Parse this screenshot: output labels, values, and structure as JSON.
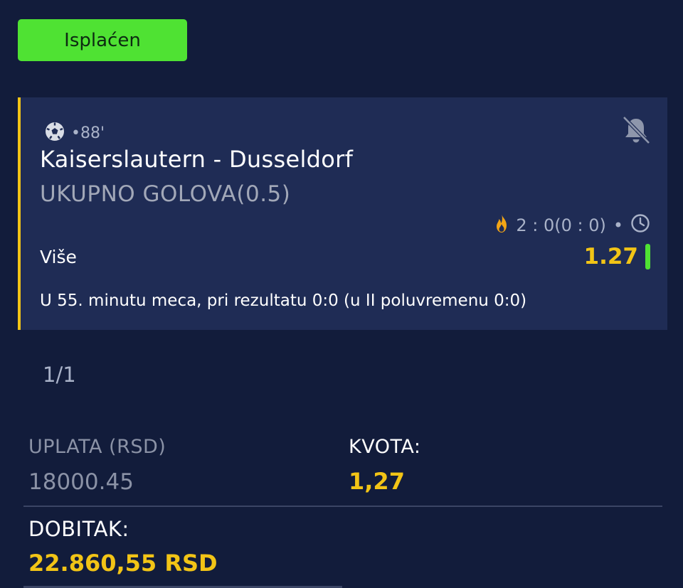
{
  "status": {
    "label": "Isplaćen",
    "color": "#4fe233"
  },
  "ticket": {
    "sport_icon": "soccer-ball-icon",
    "minute": "•88'",
    "match": "Kaiserslautern - Dusseldorf",
    "market": "UKUPNO GOLOVA(0.5)",
    "notification_icon": "bell-off-icon",
    "live_icon": "flame-icon",
    "score": "2 :  0(0 :  0)",
    "score_separator": "•",
    "clock_icon": "clock-icon",
    "pick": "Više",
    "odd": "1.27",
    "odd_indicator_color": "#4fe233",
    "comment": "U 55. minutu meca, pri rezultatu 0:0 (u II poluvremenu 0:0)",
    "accent_color": "#f2c416"
  },
  "pager": "1/1",
  "summary": {
    "stake_label": "UPLATA (RSD)",
    "stake_value": "18000.45",
    "odds_label": "KVOTA:",
    "odds_value": "1,27",
    "win_label": "DOBITAK:",
    "win_value": "22.860,55 RSD"
  }
}
